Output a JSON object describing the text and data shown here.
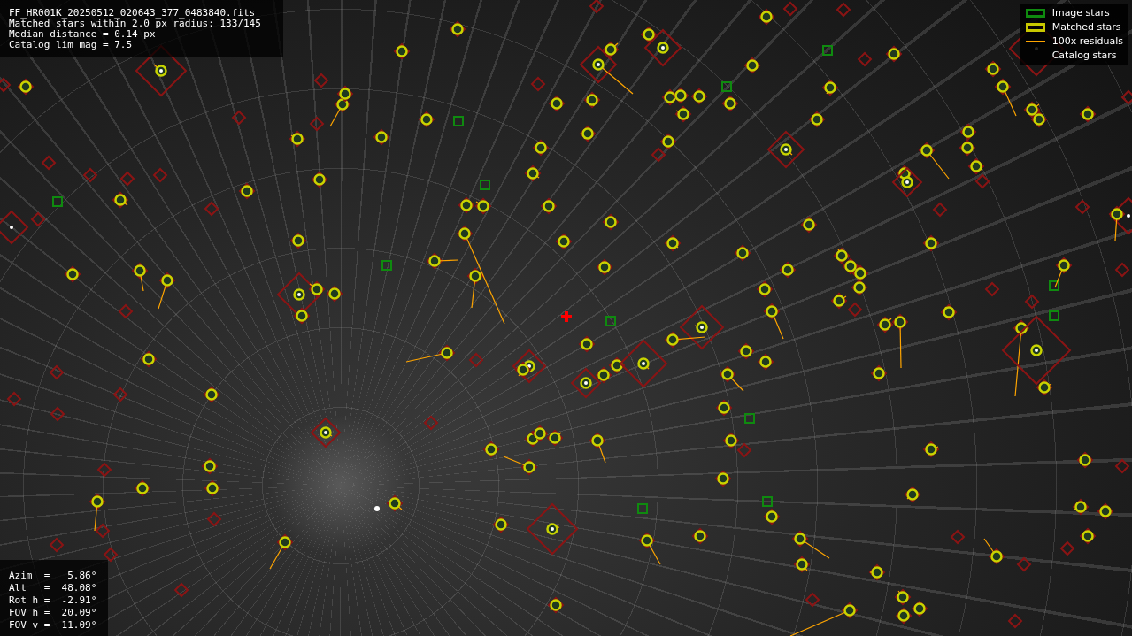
{
  "info": {
    "lines": [
      "FF_HR001K_20250512_020643_377_0483840.fits",
      "Matched stars within 2.0 px radius: 133/145",
      "Median distance = 0.14 px",
      "Catalog lim mag = 7.5"
    ]
  },
  "legend": {
    "items": [
      {
        "label": "Image stars",
        "kind": "box",
        "color": "#0f8a0f"
      },
      {
        "label": "Matched stars",
        "kind": "box",
        "color": "#c8c800"
      },
      {
        "label": "100x residuals",
        "kind": "line",
        "color": "#ffa500"
      },
      {
        "label": "Catalog stars",
        "kind": "blank"
      }
    ]
  },
  "pointing": {
    "lines": [
      "Azim  =   5.86°",
      "Alt   =  48.08°",
      "Rot h =  -2.91°",
      "FOV h =  20.09°",
      "FOV v =  11.09°"
    ]
  }
}
